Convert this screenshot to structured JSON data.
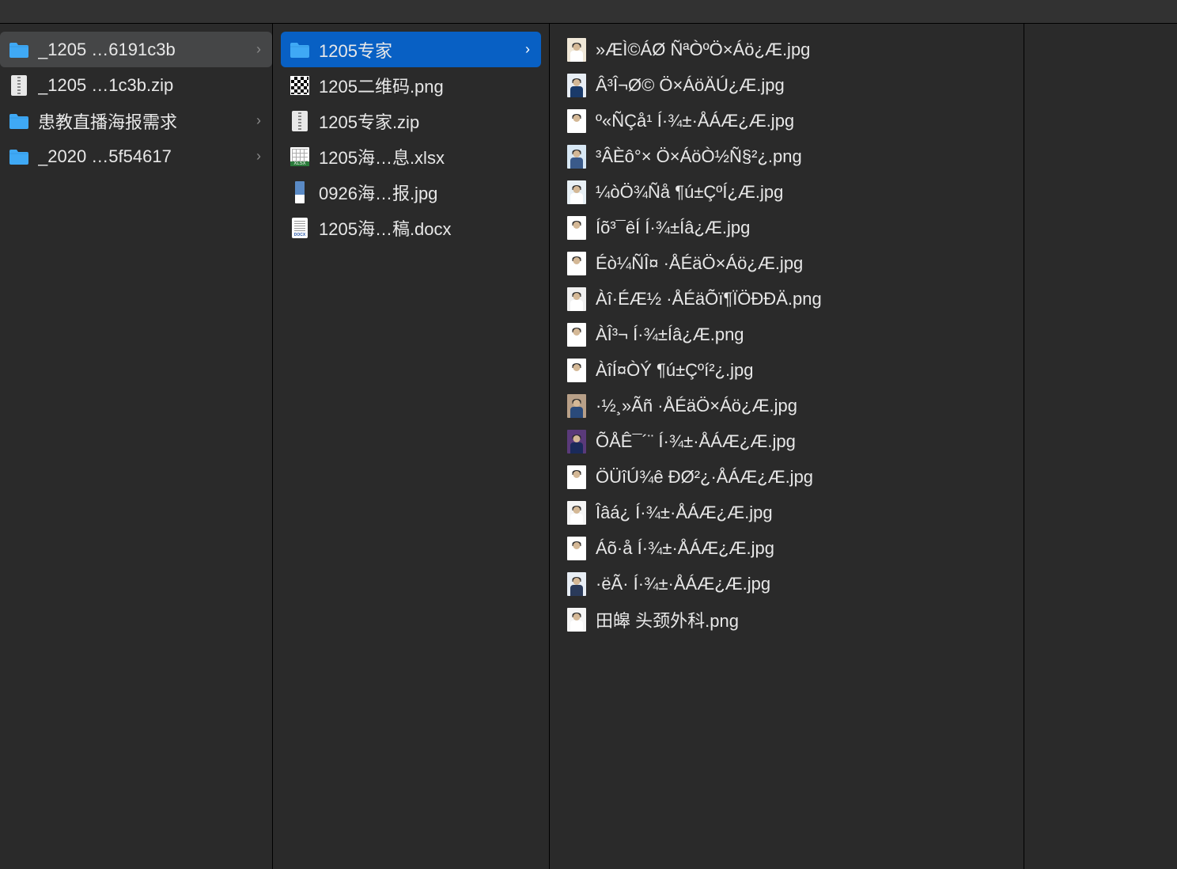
{
  "column1": {
    "items": [
      {
        "name": "_1205 …6191c3b",
        "type": "folder",
        "selected": true,
        "hasChildren": true
      },
      {
        "name": "_1205 …1c3b.zip",
        "type": "zip",
        "selected": false,
        "hasChildren": false
      },
      {
        "name": "患教直播海报需求",
        "type": "folder",
        "selected": false,
        "hasChildren": true
      },
      {
        "name": "_2020 …5f54617",
        "type": "folder",
        "selected": false,
        "hasChildren": true
      }
    ]
  },
  "column2": {
    "items": [
      {
        "name": "1205专家",
        "type": "folder",
        "selected": true,
        "hasChildren": true
      },
      {
        "name": "1205二维码.png",
        "type": "qr",
        "selected": false
      },
      {
        "name": "1205专家.zip",
        "type": "zip",
        "selected": false
      },
      {
        "name": "1205海…息.xlsx",
        "type": "xlsx",
        "selected": false
      },
      {
        "name": "0926海…报.jpg",
        "type": "img-narrow",
        "selected": false
      },
      {
        "name": "1205海…稿.docx",
        "type": "docx",
        "selected": false
      }
    ]
  },
  "column3": {
    "items": [
      {
        "name": "»ÆÌ©ÁØ ÑªÒºÖ×Áö¿Æ.jpg",
        "bodyColor": "#ffffff",
        "bg": "#f0e8d8"
      },
      {
        "name": "Â³Î¬Ø© Ö×ÁöÄÚ¿Æ.jpg",
        "bodyColor": "#1a3a6a",
        "bg": "#e8eef5"
      },
      {
        "name": "º«ÑÇå¹ Í·¾±·ÅÁÆ¿Æ.jpg",
        "bodyColor": "#ffffff",
        "bg": "#ffffff"
      },
      {
        "name": "³ÂÈô°× Ö×ÁöÒ½Ñ§²¿.png",
        "bodyColor": "#3a5a8a",
        "bg": "#d8e8f5"
      },
      {
        "name": "¼òÖ¾Ñå ¶ú±ÇºÍ¿Æ.jpg",
        "bodyColor": "#ffffff",
        "bg": "#e8f0f5"
      },
      {
        "name": "Íõ³¯êÍ Í·¾±Íâ¿Æ.jpg",
        "bodyColor": "#ffffff",
        "bg": "#ffffff"
      },
      {
        "name": "Éò¼ÑÎ¤ ·ÅÉäÖ×Áö¿Æ.jpg",
        "bodyColor": "#ffffff",
        "bg": "#ffffff"
      },
      {
        "name": "Àî·ÉÆ½ ·ÅÉäÕï¶ÏÖÐÐÄ.png",
        "bodyColor": "#ffffff",
        "bg": "#f0f0f0"
      },
      {
        "name": "ÀÎ³¬ Í·¾±Íâ¿Æ.png",
        "bodyColor": "#ffffff",
        "bg": "#ffffff"
      },
      {
        "name": "ÀîÍ¤ÒÝ ¶ú±Çºí²¿.jpg",
        "bodyColor": "#ffffff",
        "bg": "#ffffff"
      },
      {
        "name": "·½¸»Ãñ ·ÅÉäÖ×Áö¿Æ.jpg",
        "bodyColor": "#2a4a7a",
        "bg": "#b8a088"
      },
      {
        "name": "ÕÅÊ¯´¨ Í·¾±·ÅÁÆ¿Æ.jpg",
        "bodyColor": "#1a2a5a",
        "bg": "#5a3a7a"
      },
      {
        "name": "ÖÜîÚ¾ê ÐØ²¿·ÅÁÆ¿Æ.jpg",
        "bodyColor": "#ffffff",
        "bg": "#ffffff"
      },
      {
        "name": "Îâá¿ Í·¾±·ÅÁÆ¿Æ.jpg",
        "bodyColor": "#ffffff",
        "bg": "#f5f5f5"
      },
      {
        "name": "Áõ·å Í·¾±·ÅÁÆ¿Æ.jpg",
        "bodyColor": "#ffffff",
        "bg": "#ffffff"
      },
      {
        "name": "·ëÃ· Í·¾±·ÅÁÆ¿Æ.jpg",
        "bodyColor": "#2a3a5a",
        "bg": "#e8eef5"
      },
      {
        "name": "田皞 头颈外科.png",
        "bodyColor": "#ffffff",
        "bg": "#f5f5f5"
      }
    ]
  }
}
